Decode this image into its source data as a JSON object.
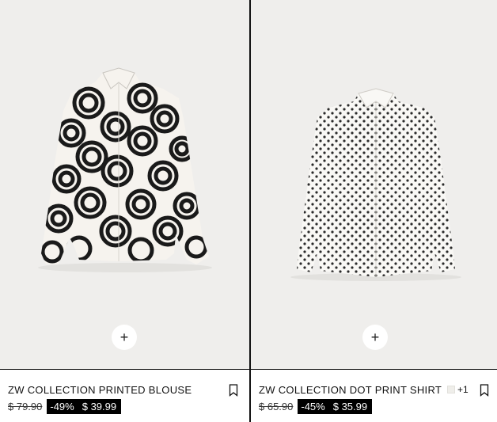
{
  "products": [
    {
      "name": "ZW COLLECTION PRINTED BLOUSE",
      "original_price": "$ 79.90",
      "discount": "-49%",
      "sale_price": "$ 39.99",
      "image_description_icon": "printed-blouse-image",
      "add_label": "+"
    },
    {
      "name": "ZW COLLECTION DOT PRINT SHIRT",
      "original_price": "$ 65.90",
      "discount": "-45%",
      "sale_price": "$ 35.99",
      "more_colors": "+1",
      "swatch_color": "#efeeea",
      "image_description_icon": "dot-print-shirt-image",
      "add_label": "+"
    }
  ],
  "colors": {
    "image_background": "#efeeec",
    "price_tag_background": "#000000",
    "divider": "#111111"
  }
}
